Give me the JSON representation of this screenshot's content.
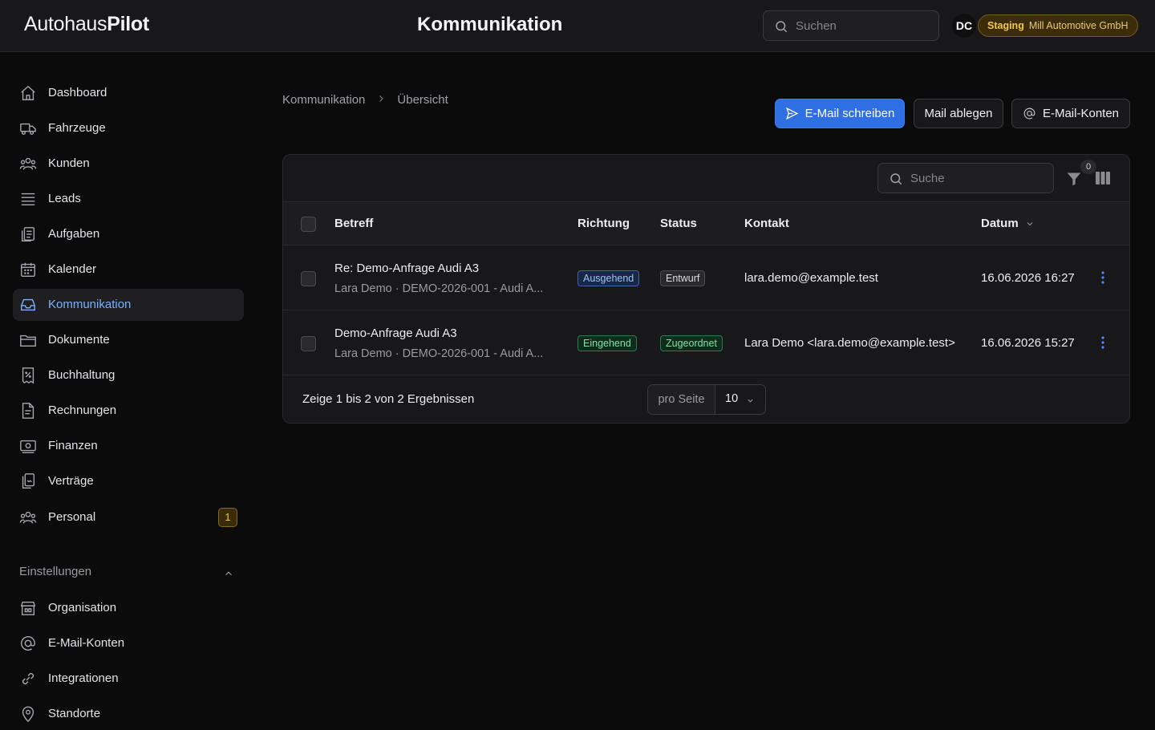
{
  "header": {
    "logo_part1": "Autohaus",
    "logo_part2": "Pilot",
    "title": "Kommunikation",
    "search_placeholder": "Suchen",
    "avatar_initials": "DC",
    "env_label": "Staging",
    "org_name": "Mill Automotive GmbH"
  },
  "sidebar": {
    "items": [
      {
        "label": "Dashboard",
        "icon": "home-icon"
      },
      {
        "label": "Fahrzeuge",
        "icon": "truck-icon"
      },
      {
        "label": "Kunden",
        "icon": "users-icon"
      },
      {
        "label": "Leads",
        "icon": "stack-icon"
      },
      {
        "label": "Aufgaben",
        "icon": "clipboard-icon"
      },
      {
        "label": "Kalender",
        "icon": "calendar-icon"
      },
      {
        "label": "Kommunikation",
        "icon": "inbox-icon",
        "active": true
      },
      {
        "label": "Dokumente",
        "icon": "folder-icon"
      },
      {
        "label": "Buchhaltung",
        "icon": "receipt-icon"
      },
      {
        "label": "Rechnungen",
        "icon": "document-icon"
      },
      {
        "label": "Finanzen",
        "icon": "banknote-icon"
      },
      {
        "label": "Verträge",
        "icon": "contracts-icon"
      },
      {
        "label": "Personal",
        "icon": "team-icon",
        "badge": "1"
      }
    ],
    "settings_label": "Einstellungen",
    "settings_items": [
      {
        "label": "Organisation",
        "icon": "building-icon"
      },
      {
        "label": "E-Mail-Konten",
        "icon": "at-sign-icon"
      },
      {
        "label": "Integrationen",
        "icon": "link-icon"
      },
      {
        "label": "Standorte",
        "icon": "map-pin-icon"
      }
    ]
  },
  "breadcrumb": {
    "root": "Kommunikation",
    "current": "Übersicht"
  },
  "actions": {
    "compose": "E-Mail schreiben",
    "file_mail": "Mail ablegen",
    "accounts": "E-Mail-Konten"
  },
  "table": {
    "search_placeholder": "Suche",
    "filter_count": "0",
    "columns": {
      "subject": "Betreff",
      "direction": "Richtung",
      "status": "Status",
      "contact": "Kontakt",
      "date": "Datum"
    },
    "rows": [
      {
        "subject": "Re: Demo-Anfrage Audi A3",
        "meta": "Lara Demo · DEMO-2026-001 - Audi A...",
        "direction": "Ausgehend",
        "status": "Entwurf",
        "contact": "lara.demo@example.test",
        "date": "16.06.2026 16:27"
      },
      {
        "subject": "Demo-Anfrage Audi A3",
        "meta": "Lara Demo · DEMO-2026-001 - Audi A...",
        "direction": "Eingehend",
        "status": "Zugeordnet",
        "contact": "Lara Demo <lara.demo@example.test>",
        "date": "16.06.2026 15:27"
      }
    ],
    "results_text": "Zeige 1 bis 2 von 2 Ergebnissen",
    "per_page_label": "pro Seite",
    "per_page_value": "10"
  },
  "colors": {
    "accent": "#2f6fe4",
    "active_nav_text": "#7ab0ff",
    "warning": "#f5c64a"
  }
}
